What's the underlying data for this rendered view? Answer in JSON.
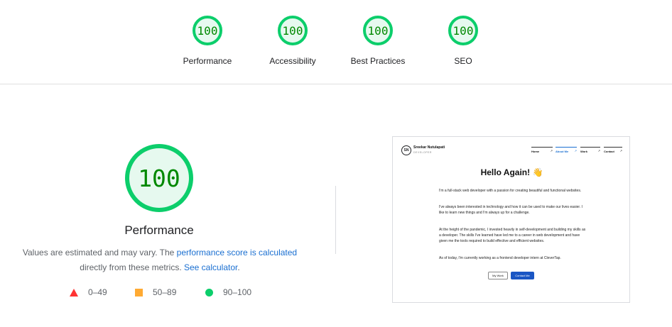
{
  "top_gauges": [
    {
      "score": "100",
      "label": "Performance"
    },
    {
      "score": "100",
      "label": "Accessibility"
    },
    {
      "score": "100",
      "label": "Best Practices"
    },
    {
      "score": "100",
      "label": "SEO"
    }
  ],
  "main": {
    "score": "100",
    "title": "Performance",
    "desc_prefix": "Values are estimated and may vary. The ",
    "desc_link1": "performance score is calculated",
    "desc_middle": "directly from these metrics. ",
    "desc_link2": "See calculator",
    "desc_suffix": ".",
    "colors": {
      "pass": "#0cce6b",
      "average": "#ffaa33",
      "fail": "#ff3333",
      "link": "#1a6fd1"
    }
  },
  "legend": [
    {
      "icon": "red-triangle-icon",
      "range": "0–49"
    },
    {
      "icon": "orange-square-icon",
      "range": "50–89"
    },
    {
      "icon": "green-circle-icon",
      "range": "90–100"
    }
  ],
  "thumbnail": {
    "logo": "SN",
    "name": "Sreekar Nutulapati",
    "role": "DEVELOPER",
    "nav": [
      "Home",
      "About Me",
      "Work",
      "Contact"
    ],
    "nav_arrow": "↗",
    "heading": "Hello Again! 👋",
    "paragraphs": [
      "I'm a full-stack web developer with a passion for creating beautiful and functional websites.",
      "I've always been interested in technology and how it can be used to make our lives easier. I like to learn new things and I'm always up for a challenge.",
      "At the height of the pandemic, I invested heavily in self-development and building my skills as a developer. The skills I've learned have led me to a career in web development and have given me the tools required to build effective and efficient websites.",
      "As of today, I'm currently working as a frontend developer intern at CleverTap."
    ],
    "buttons": [
      "My Work",
      "Contact Me"
    ]
  }
}
